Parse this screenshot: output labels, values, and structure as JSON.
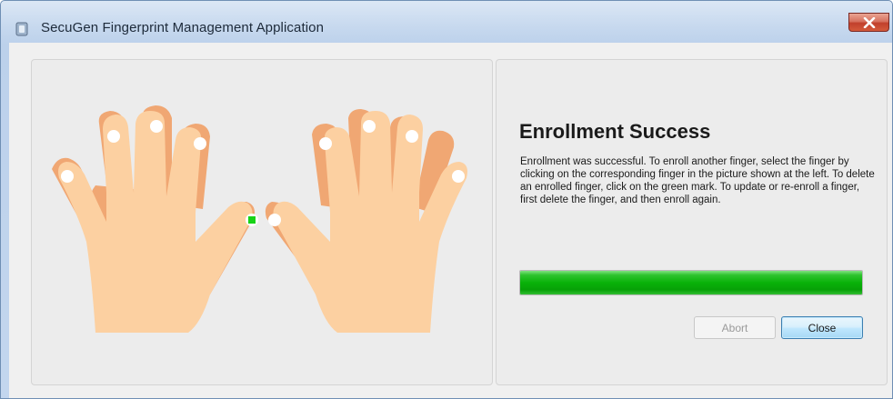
{
  "window": {
    "title": "SecuGen Fingerprint Management Application",
    "icon": "app-icon",
    "close_icon": "close-icon"
  },
  "colors": {
    "skin": "#fcd0a1",
    "skin_shadow": "#f0a773",
    "enrolled_mark": "#17d317",
    "progress": "#0ab10a",
    "title_bar": "#c6d8ee",
    "close_button": "#c84c3a"
  },
  "hands": {
    "left_hand_label": "",
    "right_hand_label": "",
    "enrolled_fingers": [
      "left-thumb"
    ]
  },
  "status": {
    "heading": "Enrollment Success",
    "message": "Enrollment was successful. To enroll another finger, select the finger by clicking on the corresponding finger in the picture shown at the left. To delete an enrolled finger, click on the green mark. To update or re-enroll a finger, first delete the finger, and then enroll again.",
    "progress_percent": 100
  },
  "buttons": {
    "abort": "Abort",
    "close": "Close",
    "abort_enabled": false
  }
}
